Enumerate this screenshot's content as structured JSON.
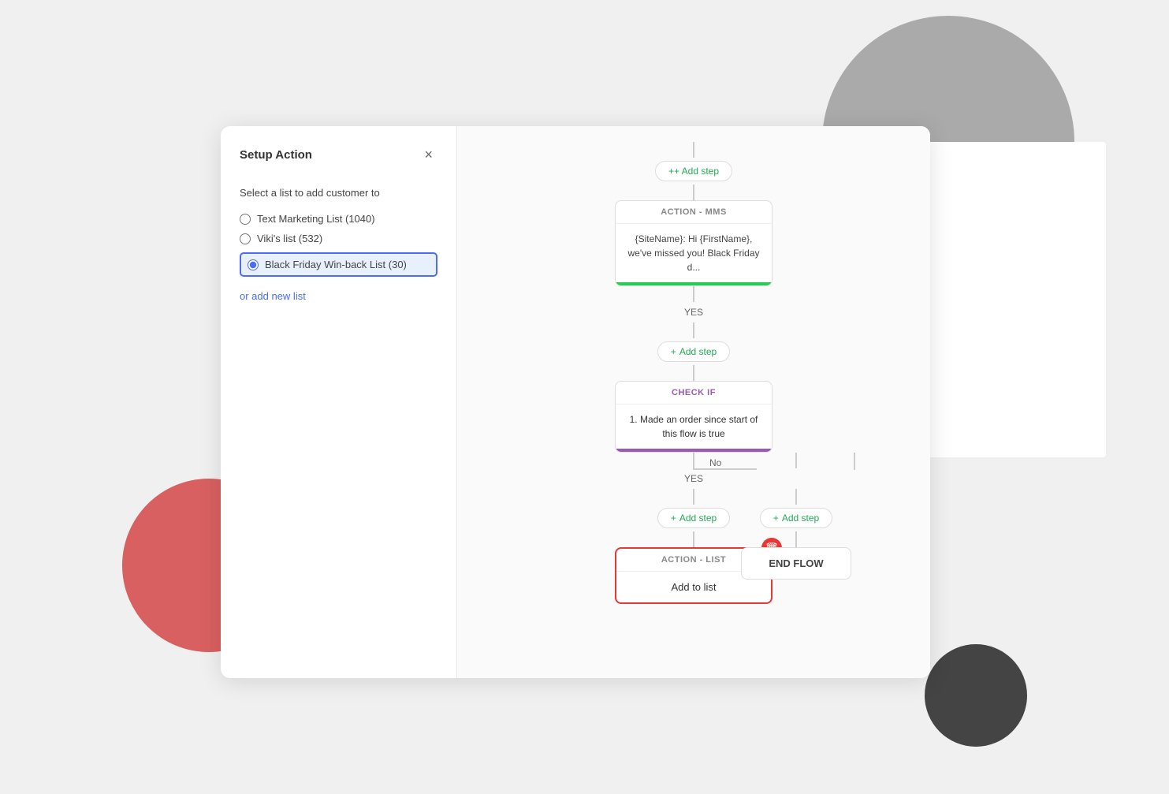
{
  "background": {
    "circle_gray": "gray decorative circle top right",
    "circle_red": "red decorative circle bottom left",
    "circle_dark": "dark decorative circle bottom right"
  },
  "setup_panel": {
    "title": "Setup Action",
    "close_label": "×",
    "subtitle": "Select a list to add customer to",
    "list_options": [
      {
        "id": "opt1",
        "label": "Text Marketing List (1040)",
        "selected": false
      },
      {
        "id": "opt2",
        "label": "Viki's list (532)",
        "selected": false
      },
      {
        "id": "opt3",
        "label": "Black Friday Win-back List (30)",
        "selected": true
      }
    ],
    "add_new_list_label": "or add new list"
  },
  "flow": {
    "add_step_label": "+ Add step",
    "action_mms": {
      "header": "ACTION - MMS",
      "body": "{SiteName}: Hi {FirstName}, we've missed you! Black Friday d..."
    },
    "yes_label_1": "YES",
    "check_if": {
      "header": "CHECK IF",
      "condition": "1. Made an order since start of this flow is true"
    },
    "yes_label_2": "YES",
    "no_label": "No",
    "action_list": {
      "header": "ACTION - LIST",
      "body": "Add to list"
    },
    "end_flow": {
      "label": "END FLOW"
    }
  }
}
